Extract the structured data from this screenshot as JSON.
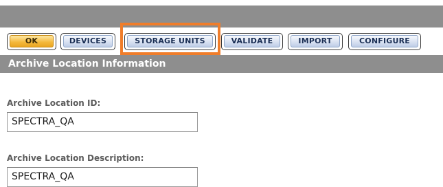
{
  "tabs": [
    {
      "label": "OK"
    },
    {
      "label": "DEVICES"
    },
    {
      "label": "STORAGE UNITS"
    },
    {
      "label": "VALIDATE"
    },
    {
      "label": "IMPORT"
    },
    {
      "label": "CONFIGURE"
    }
  ],
  "section": {
    "title": "Archive Location Information"
  },
  "form": {
    "location_id": {
      "label": "Archive Location ID:",
      "value": "SPECTRA_QA"
    },
    "location_description": {
      "label": "Archive Location Description:",
      "value": "SPECTRA_QA"
    }
  },
  "colors": {
    "header_bar": "#8e8e8e",
    "ok_button": "#f4b83a",
    "tab_button": "#d9e2f2",
    "highlight_outline": "#f07d2a"
  }
}
